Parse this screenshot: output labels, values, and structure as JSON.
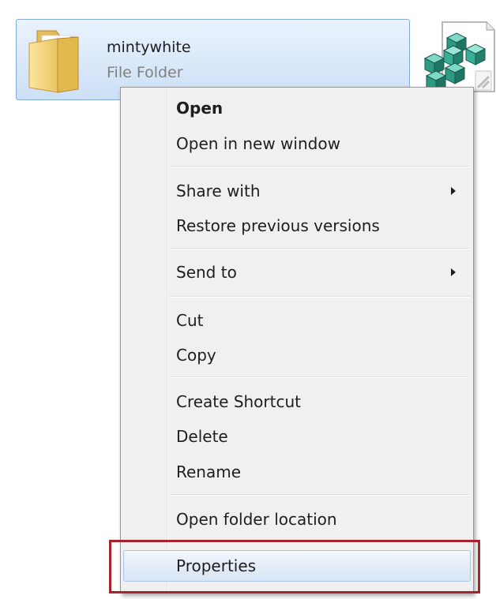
{
  "file": {
    "name": "mintywhite",
    "type": "File Folder",
    "icon": "folder-icon"
  },
  "neighbor_file": {
    "icon": "registry-file-icon"
  },
  "context_menu": {
    "groups": [
      {
        "items": [
          {
            "label": "Open",
            "bold": true,
            "submenu": false
          },
          {
            "label": "Open in new window",
            "bold": false,
            "submenu": false
          }
        ]
      },
      {
        "items": [
          {
            "label": "Share with",
            "bold": false,
            "submenu": true
          },
          {
            "label": "Restore previous versions",
            "bold": false,
            "submenu": false
          }
        ]
      },
      {
        "items": [
          {
            "label": "Send to",
            "bold": false,
            "submenu": true
          }
        ]
      },
      {
        "items": [
          {
            "label": "Cut",
            "bold": false,
            "submenu": false
          },
          {
            "label": "Copy",
            "bold": false,
            "submenu": false
          }
        ]
      },
      {
        "items": [
          {
            "label": "Create Shortcut",
            "bold": false,
            "submenu": false
          },
          {
            "label": "Delete",
            "bold": false,
            "submenu": false
          },
          {
            "label": "Rename",
            "bold": false,
            "submenu": false
          }
        ]
      },
      {
        "items": [
          {
            "label": "Open folder location",
            "bold": false,
            "submenu": false
          }
        ]
      },
      {
        "items": [
          {
            "label": "Properties",
            "bold": false,
            "submenu": false,
            "hovered": true,
            "highlighted": true
          }
        ]
      }
    ]
  },
  "colors": {
    "selection_border": "#84acdd",
    "menu_background": "#f0f0f0",
    "hover_border": "#a8c6ec",
    "annotation_red": "#a8242a"
  }
}
